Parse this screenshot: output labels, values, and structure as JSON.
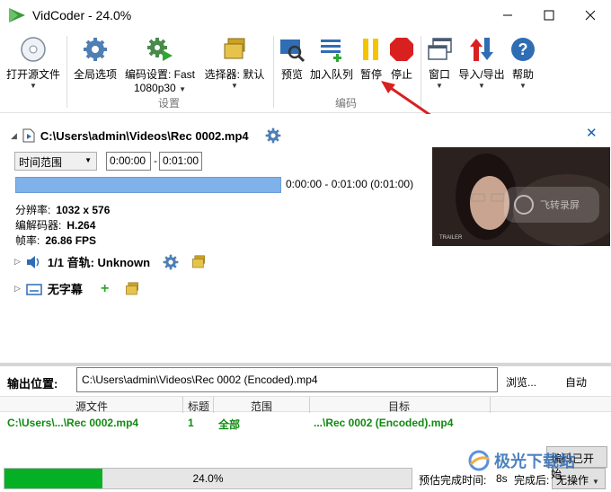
{
  "window": {
    "title": "VidCoder - 24.0%",
    "minimize_icon": "minimize-icon",
    "maximize_icon": "maximize-icon",
    "close_icon": "close-icon"
  },
  "ribbon": {
    "open_source": "打开源文件",
    "global_options": "全局选项",
    "encode_settings": "编码设置:",
    "encode_preset": "Fast",
    "encode_preset_sub": "1080p30",
    "picker": "选择器:",
    "picker_value": "默认",
    "settings_group": "设置",
    "preview": "预览",
    "add_queue": "加入队列",
    "pause": "暂停",
    "stop": "停止",
    "encode_group": "编码",
    "window": "窗口",
    "import_export": "导入/导出",
    "help": "帮助"
  },
  "source": {
    "path": "C:\\Users\\admin\\Videos\\Rec 0002.mp4",
    "range_mode": "时间范围",
    "start_time": "0:00:00",
    "end_time": "0:01:00",
    "dash": "-",
    "range_text": "0:00:00 - 0:01:00  (0:01:00)",
    "resolution_label": "分辨率:",
    "resolution": "1032 x 576",
    "codec_label": "编解码器:",
    "codec": "H.264",
    "fps_label": "帧率:",
    "fps": "26.86 FPS",
    "audio_track": "1/1 音轨: Unknown",
    "subtitles": "无字幕",
    "preview_overlay": "飞转录屏",
    "preview_caption": "TRAILER"
  },
  "output": {
    "label": "输出位置:",
    "path": "C:\\Users\\admin\\Videos\\Rec 0002 (Encoded).mp4",
    "browse": "浏览...",
    "auto": "自动"
  },
  "queue": {
    "headers": [
      "源文件",
      "标题",
      "范围",
      "目标"
    ],
    "rows": [
      {
        "source": "C:\\Users\\...\\Rec 0002.mp4",
        "title": "1",
        "range": "全部",
        "target": "...\\Rec 0002 (Encoded).mp4"
      }
    ]
  },
  "status": {
    "progress": 24.0,
    "progress_text": "24.0%",
    "eta_label": "预估完成时间:",
    "eta": "8s",
    "after_label": "完成后:",
    "after_value": "无操作",
    "encode_start": "编码已开始",
    "watermark": "极光下载站"
  },
  "colors": {
    "progress_fill": "#06b025",
    "queue_text": "#118a11",
    "accent": "#1a5fb4",
    "pause_yellow": "#f5c400",
    "stop_red": "#d92020"
  }
}
